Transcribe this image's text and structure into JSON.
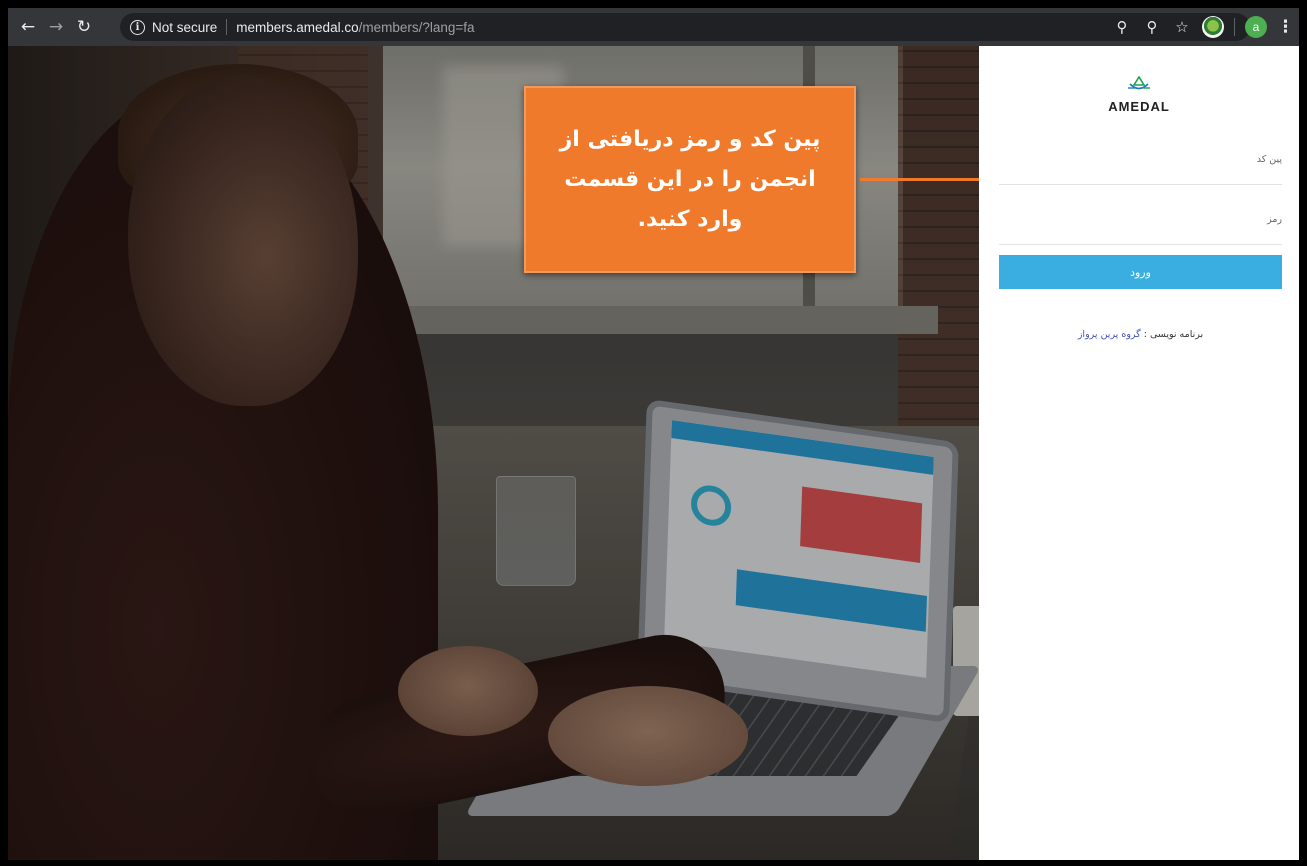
{
  "browser": {
    "security_label": "Not secure",
    "url_host": "members.amedal.co",
    "url_path": "/members/?lang=fa",
    "profile_initial": "a"
  },
  "callout": {
    "text": "پین کد و رمز دریافتی از انجمن را در این قسمت وارد کنید."
  },
  "login": {
    "logo_text": "AMEDAL",
    "pin_label": "پین کد",
    "pin_value": "",
    "password_label": "رمز",
    "password_value": "",
    "submit_label": "ورود",
    "credit_prefix": "برنامه نویسی :",
    "credit_link": "گروه پرین پرواز"
  },
  "colors": {
    "accent": "#3aaee0",
    "callout": "#f07a2b",
    "link": "#3f51b5"
  }
}
